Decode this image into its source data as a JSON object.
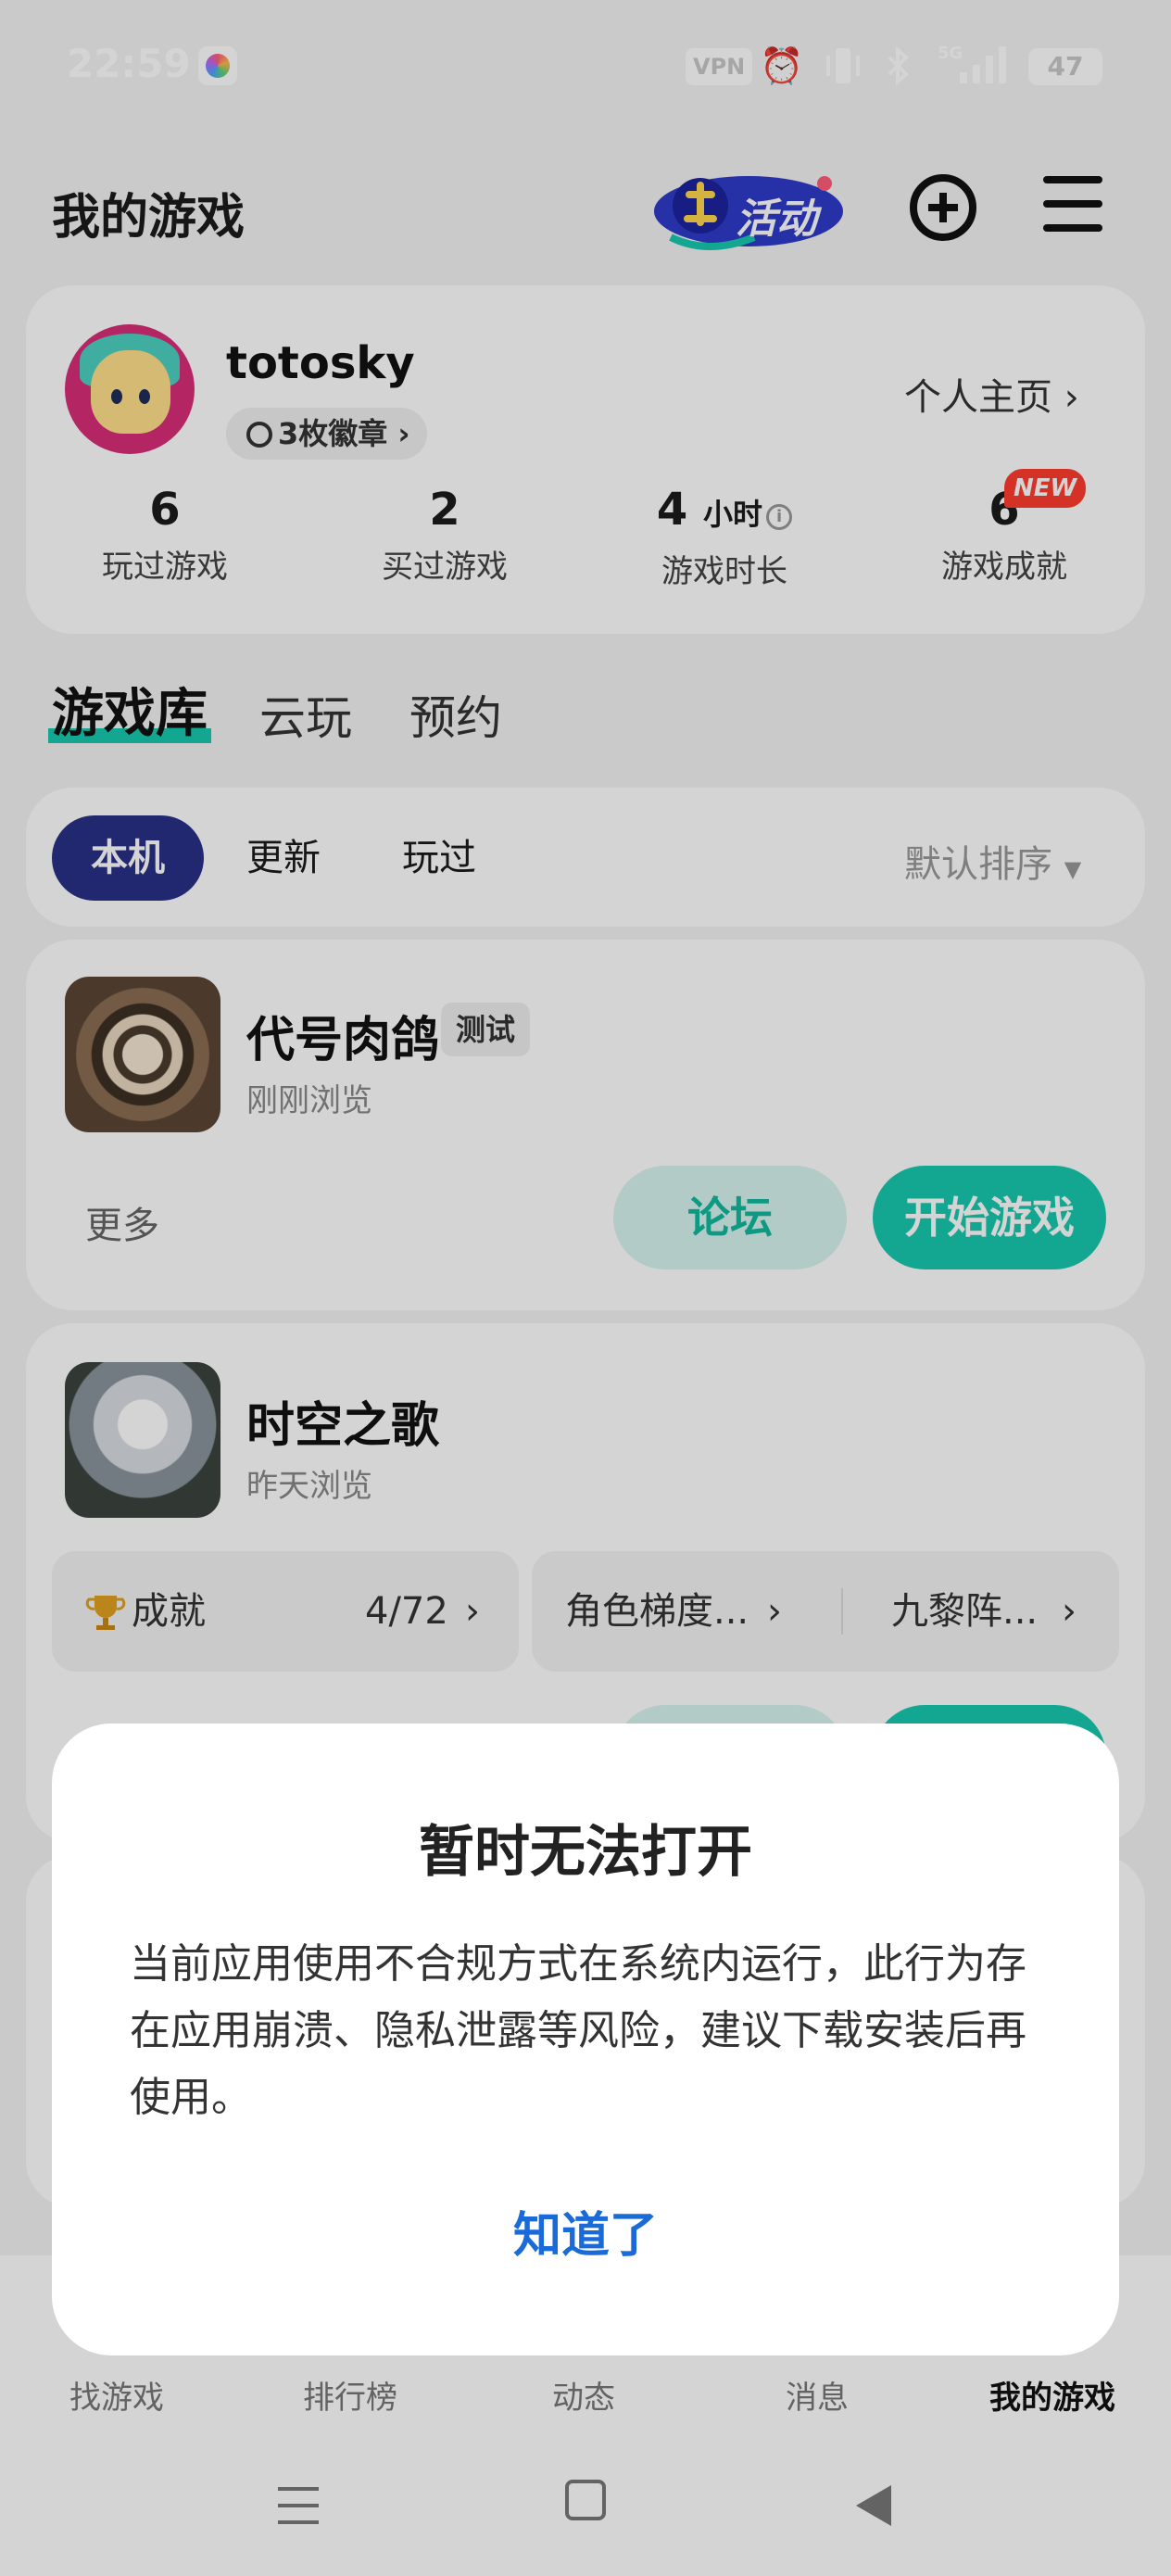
{
  "status_bar": {
    "time": "22:59",
    "vpn_label": "VPN",
    "network_label": "5G",
    "battery": "47",
    "icons": [
      "app-badge-icon",
      "alarm-icon",
      "vibrate-icon",
      "bluetooth-icon",
      "signal-icon",
      "battery-icon"
    ]
  },
  "header": {
    "title": "我的游戏",
    "activity_label": "活动",
    "plus_icon": "plus-circle-icon",
    "menu_icon": "menu-icon"
  },
  "profile": {
    "username": "totosky",
    "badge_label": "3枚徽章",
    "homepage_label": "个人主页",
    "stats": [
      {
        "value": "6",
        "unit": "",
        "label": "玩过游戏"
      },
      {
        "value": "2",
        "unit": "",
        "label": "买过游戏"
      },
      {
        "value": "4",
        "unit": "小时",
        "label": "游戏时长"
      },
      {
        "value": "6",
        "unit": "",
        "label": "游戏成就"
      }
    ],
    "new_badge": "NEW"
  },
  "tabs": [
    {
      "label": "游戏库",
      "active": true
    },
    {
      "label": "云玩",
      "active": false
    },
    {
      "label": "预约",
      "active": false
    }
  ],
  "filters": {
    "chips": [
      "本机",
      "更新",
      "玩过"
    ],
    "active": "本机",
    "sort_label": "默认排序"
  },
  "games": [
    {
      "name": "代号肉鸽",
      "tag": "测试",
      "subtitle": "刚刚浏览",
      "more_label": "更多",
      "forum_label": "论坛",
      "play_label": "开始游戏"
    },
    {
      "name": "时空之歌",
      "subtitle": "昨天浏览",
      "achievement_label": "成就",
      "achievement_count": "4/72",
      "guide1": "角色梯度...",
      "guide2": "九黎阵..."
    }
  ],
  "bottom_nav": [
    {
      "label": "找游戏",
      "active": false
    },
    {
      "label": "排行榜",
      "active": false
    },
    {
      "label": "动态",
      "active": false
    },
    {
      "label": "消息",
      "active": false
    },
    {
      "label": "我的游戏",
      "active": true
    }
  ],
  "dialog": {
    "title": "暂时无法打开",
    "message": "当前应用使用不合规方式在系统内运行，此行为存在应用崩溃、隐私泄露等风险，建议下载安装后再使用。",
    "ok_label": "知道了"
  },
  "colors": {
    "accent": "#17c9b0",
    "chip_active": "#283186",
    "dialog_button": "#1a6bd8",
    "new_badge": "#ff3b30"
  }
}
